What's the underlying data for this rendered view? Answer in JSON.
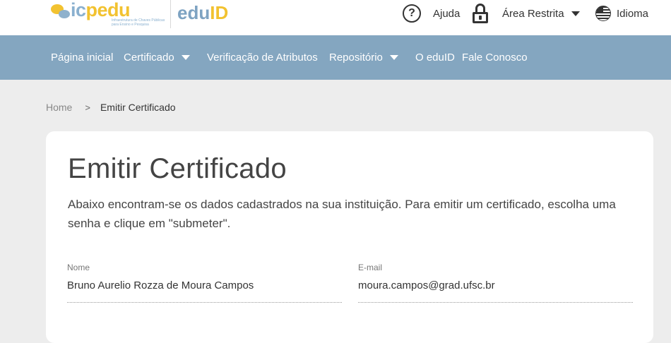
{
  "header": {
    "logo_icp_ic": "ic",
    "logo_icp_pedu": "pedu",
    "logo_icp_tagline": "Infraestrutura de Chaves Públicas para Ensino e Pesquisa",
    "logo_eduid_edu": "edu",
    "logo_eduid_id": "ID",
    "help_label": "Ajuda",
    "restricted_label": "Área Restrita",
    "language_label": "Idioma"
  },
  "nav": {
    "items": [
      {
        "label": "Página inicial"
      },
      {
        "label": "Certificado"
      },
      {
        "label": "Verificação de Atributos"
      },
      {
        "label": "Repositório"
      },
      {
        "label": "O eduID"
      },
      {
        "label": "Fale Conosco"
      }
    ]
  },
  "breadcrumb": {
    "home": "Home",
    "separator": ">",
    "current": "Emitir Certificado"
  },
  "main": {
    "title": "Emitir Certificado",
    "intro": "Abaixo encontram-se os dados cadastrados na sua instituição. Para emitir um certificado, escolha uma senha e clique em \"submeter\".",
    "fields": {
      "nome": {
        "label": "Nome",
        "value": "Bruno Aurelio Rozza de Moura Campos"
      },
      "email": {
        "label": "E-mail",
        "value": "moura.campos@grad.ufsc.br"
      }
    }
  },
  "colors": {
    "navbar": "#84a6c0",
    "brand_yellow": "#f2c230",
    "brand_blue": "#8ab0cf",
    "page_bg": "#ededed"
  },
  "icons": [
    "help-circle-icon",
    "lock-icon",
    "caret-down-icon",
    "language-flag-icon"
  ]
}
